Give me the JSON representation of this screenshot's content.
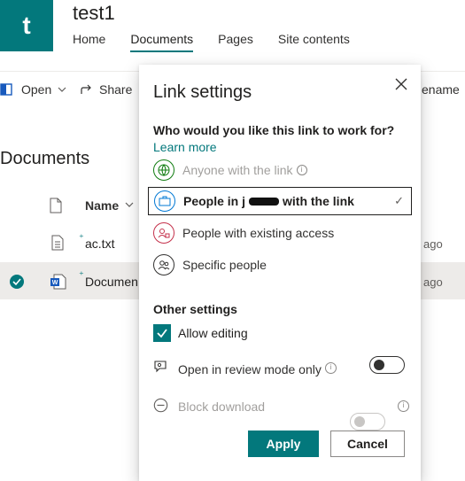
{
  "site": {
    "logo_letter": "t",
    "title": "test1"
  },
  "nav": {
    "items": [
      "Home",
      "Documents",
      "Pages",
      "Site contents"
    ],
    "active": "Documents"
  },
  "command_bar": {
    "open": "Open",
    "share": "Share",
    "rename": "ename"
  },
  "library": {
    "heading": "Documents",
    "column_name": "Name",
    "rows": [
      {
        "name": "ac.txt",
        "modified": "ago",
        "selected": false
      },
      {
        "name": "Documen",
        "modified": "ago",
        "selected": true
      }
    ]
  },
  "dialog": {
    "title": "Link settings",
    "question": "Who would you like this link to work for?",
    "learn_more": "Learn more",
    "options": [
      {
        "label": "Anyone with the link",
        "icon": "globe-icon",
        "state": "disabled"
      },
      {
        "label_start": "People in j",
        "label_end": "with the link",
        "icon": "organization-icon",
        "state": "selected"
      },
      {
        "label": "People with existing access",
        "icon": "existing-access-icon",
        "state": "normal"
      },
      {
        "label": "Specific people",
        "icon": "people-icon",
        "state": "normal"
      }
    ],
    "other_settings": "Other settings",
    "allow_editing": "Allow editing",
    "review_mode": "Open in review mode only",
    "block_download": "Block download",
    "apply": "Apply",
    "cancel": "Cancel"
  },
  "colors": {
    "accent": "#03787c",
    "text": "#201f1e",
    "muted": "#a19f9d"
  }
}
